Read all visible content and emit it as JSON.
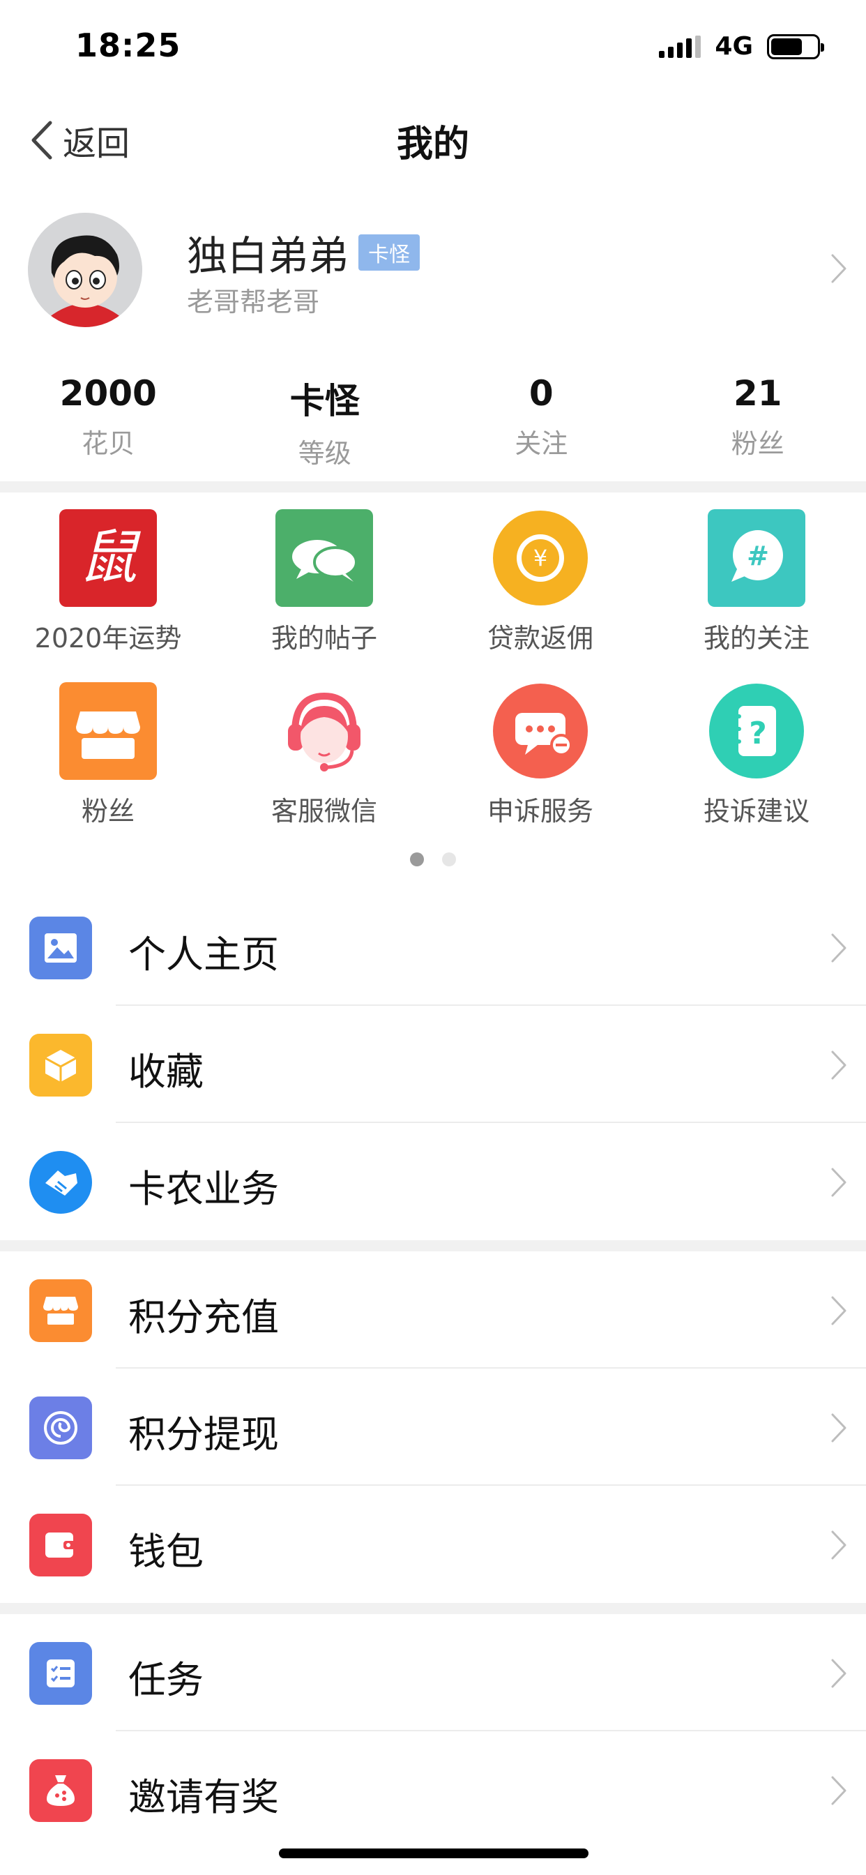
{
  "status_bar": {
    "time": "18:25",
    "network": "4G"
  },
  "nav": {
    "back_label": "返回",
    "title": "我的"
  },
  "profile": {
    "name": "独白弟弟",
    "badge": "卡怪",
    "subtitle": "老哥帮老哥"
  },
  "stats": [
    {
      "value": "2000",
      "label": "花贝"
    },
    {
      "value": "卡怪",
      "label": "等级"
    },
    {
      "value": "0",
      "label": "关注"
    },
    {
      "value": "21",
      "label": "粉丝"
    }
  ],
  "grid": [
    {
      "label": "2020年运势",
      "icon": "rat-zodiac-icon",
      "color": "#d9252a",
      "glyph": "鼠"
    },
    {
      "label": "我的帖子",
      "icon": "chat-bubbles-icon",
      "color": "#4caf6a"
    },
    {
      "label": "贷款返佣",
      "icon": "yen-coin-icon",
      "color": "#f6b121",
      "glyph": "¥"
    },
    {
      "label": "我的关注",
      "icon": "hashtag-bubble-icon",
      "color": "#3dc7c0",
      "glyph": "#"
    },
    {
      "label": "粉丝",
      "icon": "store-icon",
      "color": "#fb8c31"
    },
    {
      "label": "客服微信",
      "icon": "customer-service-icon",
      "color": "#f2576a"
    },
    {
      "label": "申诉服务",
      "icon": "appeal-bubble-icon",
      "color": "#f4604f"
    },
    {
      "label": "投诉建议",
      "icon": "question-note-icon",
      "color": "#2fcfb4",
      "glyph": "?"
    }
  ],
  "pager": {
    "pages": 2,
    "active": 0
  },
  "menu_groups": [
    [
      {
        "label": "个人主页",
        "icon": "image-icon",
        "color": "#5b86e5"
      },
      {
        "label": "收藏",
        "icon": "box-icon",
        "color": "#fbb82d"
      },
      {
        "label": "卡农业务",
        "icon": "handshake-icon",
        "color": "#1f8ef1"
      }
    ],
    [
      {
        "label": "积分充值",
        "icon": "store-icon",
        "color": "#fb8c31"
      },
      {
        "label": "积分提现",
        "icon": "spiral-icon",
        "color": "#6c7fe6"
      },
      {
        "label": "钱包",
        "icon": "wallet-icon",
        "color": "#f0454f"
      }
    ],
    [
      {
        "label": "任务",
        "icon": "task-list-icon",
        "color": "#5b86e5"
      },
      {
        "label": "邀请有奖",
        "icon": "money-bag-icon",
        "color": "#f0454f"
      }
    ]
  ]
}
